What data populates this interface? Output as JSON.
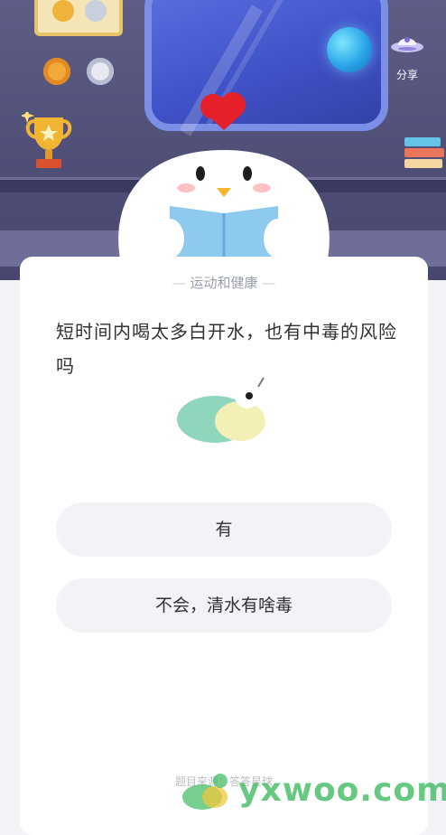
{
  "header": {
    "share_label": "分享"
  },
  "question_card": {
    "category": "运动和健康",
    "question": "短时间内喝太多白开水，也有中毒的风险吗",
    "options": [
      {
        "label": "有"
      },
      {
        "label": "不会，清水有啥毒"
      }
    ],
    "source": "题目来源：答答星球"
  },
  "watermark": {
    "text": "yxwoo.com"
  },
  "colors": {
    "scene_bg": "#56557f",
    "window_blue": "#4a5ed6",
    "option_bg": "#f1f3f7",
    "text_primary": "#2f3136",
    "text_muted": "#9aa0ab",
    "watermark_green": "#3cb95f"
  },
  "icons": [
    "badge-frame-icon",
    "gold-medal-icon",
    "silver-medal-icon",
    "trophy-icon",
    "planet-icon",
    "ufo-share-icon",
    "books-icon",
    "chick-mascot",
    "snail-icon"
  ]
}
